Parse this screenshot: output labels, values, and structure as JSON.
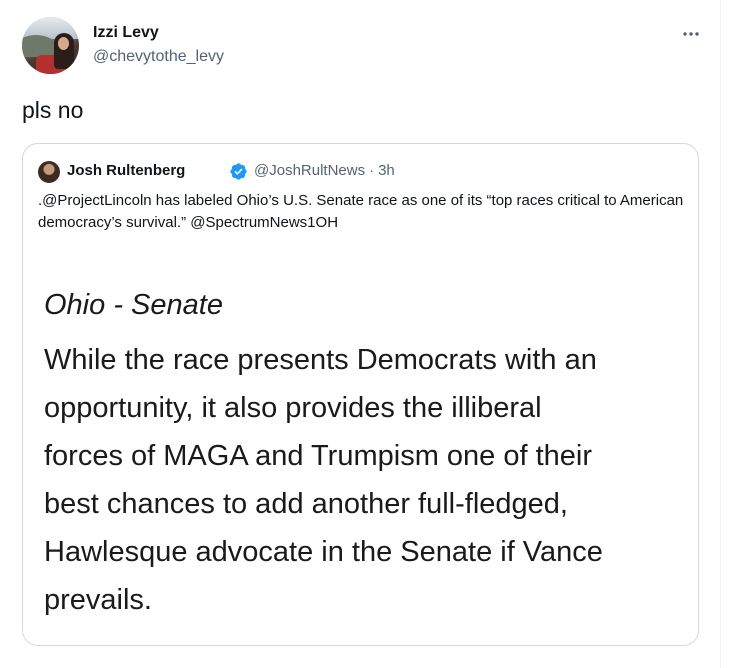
{
  "tweet": {
    "display_name": "Izzi Levy",
    "handle": "@chevytothe_levy",
    "text": "pls no",
    "more_icon": "more-horizontal-icon"
  },
  "quote": {
    "display_name": "Josh Rultenberg",
    "verified_icon": "verified-badge-icon",
    "verified_color": "#1d9bf0",
    "handle": "@JoshRultNews",
    "separator": "·",
    "time": "3h",
    "text": ".@ProjectLincoln has labeled Ohio’s U.S. Senate race as one of its “top races critical to American democracy’s survival.” @SpectrumNews1OH",
    "image": {
      "title": "Ohio - Senate",
      "lines": [
        "While the race presents Democrats with an",
        "opportunity, it also provides the illiberal",
        "forces of MAGA and Trumpism one of their",
        "best chances to add another full-fledged,",
        "Hawlesque advocate in the Senate if Vance",
        "prevails."
      ]
    }
  },
  "colors": {
    "text_primary": "#0f1419",
    "text_secondary": "#536471",
    "border": "#cfd9de"
  }
}
